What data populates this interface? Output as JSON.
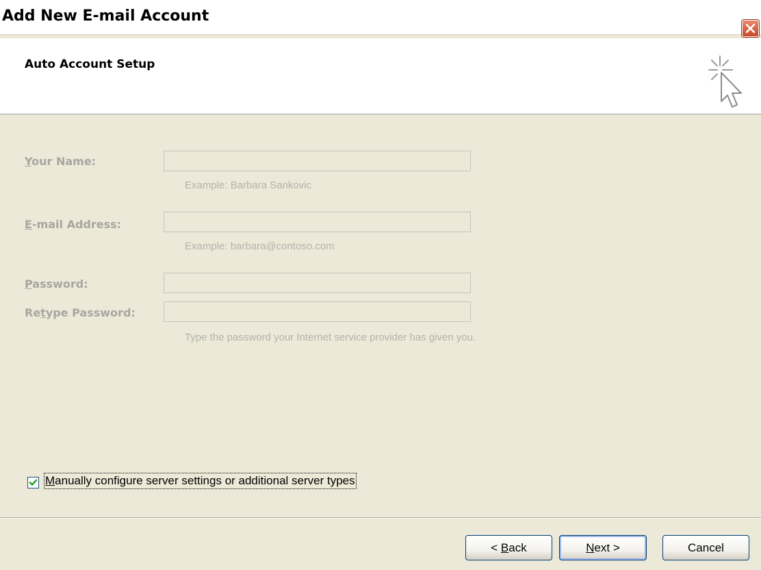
{
  "window": {
    "title": "Add New E-mail Account"
  },
  "header": {
    "title": "Auto Account Setup",
    "icon": "wizard-cursor-icon"
  },
  "form": {
    "your_name": {
      "label_underline": "Y",
      "label_rest": "our Name:",
      "value": "",
      "hint": "Example: Barbara Sankovic"
    },
    "email": {
      "label_underline": "E",
      "label_rest": "-mail Address:",
      "value": "",
      "hint": "Example: barbara@contoso.com"
    },
    "password": {
      "label_underline": "P",
      "label_rest": "assword:",
      "value": ""
    },
    "retype_password": {
      "label_before": "Re",
      "label_underline": "t",
      "label_after": "ype Password:",
      "value": "",
      "hint": "Type the password your Internet service provider has given you."
    }
  },
  "manual_config": {
    "checked": true,
    "label_underline": "M",
    "label_rest": "anually configure server settings or additional server types"
  },
  "buttons": {
    "back": {
      "before": "< ",
      "underline": "B",
      "after": "ack"
    },
    "next": {
      "underline": "N",
      "after": "ext >"
    },
    "cancel": {
      "label": "Cancel"
    }
  },
  "colors": {
    "disabled_text": "#a7a6a0",
    "button_border": "#003c74",
    "close_red": "#c9492a"
  }
}
